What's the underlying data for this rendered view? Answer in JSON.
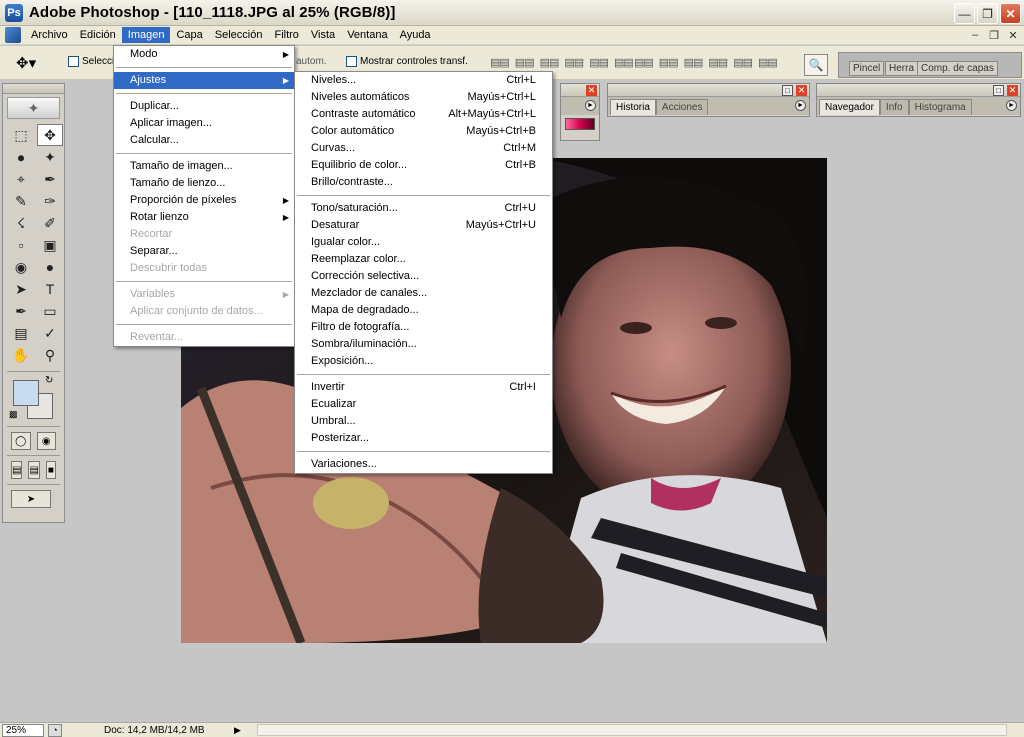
{
  "window": {
    "title": "Adobe Photoshop - [110_1118.JPG al 25% (RGB/8)]",
    "app_icon": "photoshop-icon",
    "controls": [
      "minimize-icon",
      "restore-icon",
      "close-icon"
    ]
  },
  "menubar": {
    "items": [
      "Archivo",
      "Edición",
      "Imagen",
      "Capa",
      "Selección",
      "Filtro",
      "Vista",
      "Ventana",
      "Ayuda"
    ],
    "active": "Imagen"
  },
  "options_bar": {
    "selection_label": "Selecci",
    "auto_label": "autom.",
    "show_transform": "Mostrar controles transf.",
    "palette_well_tabs": [
      "Pincel",
      "Herra",
      "Comp. de capas"
    ]
  },
  "palettes": {
    "color": {
      "tabs": []
    },
    "history": {
      "tabs": [
        "Historia",
        "Acciones"
      ]
    },
    "navigator": {
      "tabs": [
        "Navegador",
        "Info",
        "Histograma"
      ]
    }
  },
  "imagen_menu": {
    "items": [
      {
        "label": "Modo",
        "submenu": true,
        "enabled": true
      },
      {
        "sep": true
      },
      {
        "label": "Ajustes",
        "submenu": true,
        "enabled": true,
        "highlight": true
      },
      {
        "sep": true
      },
      {
        "label": "Duplicar...",
        "enabled": true
      },
      {
        "label": "Aplicar imagen...",
        "enabled": true
      },
      {
        "label": "Calcular...",
        "enabled": true
      },
      {
        "sep": true
      },
      {
        "label": "Tamaño de imagen...",
        "enabled": true
      },
      {
        "label": "Tamaño de lienzo...",
        "enabled": true
      },
      {
        "label": "Proporción de píxeles",
        "submenu": true,
        "enabled": true
      },
      {
        "label": "Rotar lienzo",
        "submenu": true,
        "enabled": true
      },
      {
        "label": "Recortar",
        "enabled": false
      },
      {
        "label": "Separar...",
        "enabled": true
      },
      {
        "label": "Descubrir todas",
        "enabled": false
      },
      {
        "sep": true
      },
      {
        "label": "Variables",
        "submenu": true,
        "enabled": false
      },
      {
        "label": "Aplicar conjunto de datos...",
        "enabled": false
      },
      {
        "sep": true
      },
      {
        "label": "Reventar...",
        "enabled": false
      }
    ]
  },
  "ajustes_menu": {
    "items": [
      {
        "label": "Niveles...",
        "shortcut": "Ctrl+L"
      },
      {
        "label": "Niveles automáticos",
        "shortcut": "Mayús+Ctrl+L"
      },
      {
        "label": "Contraste automático",
        "shortcut": "Alt+Mayús+Ctrl+L"
      },
      {
        "label": "Color automático",
        "shortcut": "Mayús+Ctrl+B"
      },
      {
        "label": "Curvas...",
        "shortcut": "Ctrl+M"
      },
      {
        "label": "Equilibrio de color...",
        "shortcut": "Ctrl+B"
      },
      {
        "label": "Brillo/contraste...",
        "shortcut": ""
      },
      {
        "sep": true
      },
      {
        "label": "Tono/saturación...",
        "shortcut": "Ctrl+U"
      },
      {
        "label": "Desaturar",
        "shortcut": "Mayús+Ctrl+U"
      },
      {
        "label": "Igualar color...",
        "shortcut": ""
      },
      {
        "label": "Reemplazar color...",
        "shortcut": ""
      },
      {
        "label": "Corrección selectiva...",
        "shortcut": ""
      },
      {
        "label": "Mezclador de canales...",
        "shortcut": ""
      },
      {
        "label": "Mapa de degradado...",
        "shortcut": ""
      },
      {
        "label": "Filtro de fotografía...",
        "shortcut": ""
      },
      {
        "label": "Sombra/iluminación...",
        "shortcut": ""
      },
      {
        "label": "Exposición...",
        "shortcut": ""
      },
      {
        "sep": true
      },
      {
        "label": "Invertir",
        "shortcut": "Ctrl+I"
      },
      {
        "label": "Ecualizar",
        "shortcut": ""
      },
      {
        "label": "Umbral...",
        "shortcut": ""
      },
      {
        "label": "Posterizar...",
        "shortcut": ""
      },
      {
        "sep": true
      },
      {
        "label": "Variaciones...",
        "shortcut": ""
      }
    ]
  },
  "status": {
    "zoom": "25%",
    "doc_info": "Doc: 14,2 MB/14,2 MB"
  },
  "colors": {
    "menu_highlight": "#316ac5",
    "foreground_swatch": "#c9dbf0",
    "background_swatch": "#e7e6e0"
  }
}
